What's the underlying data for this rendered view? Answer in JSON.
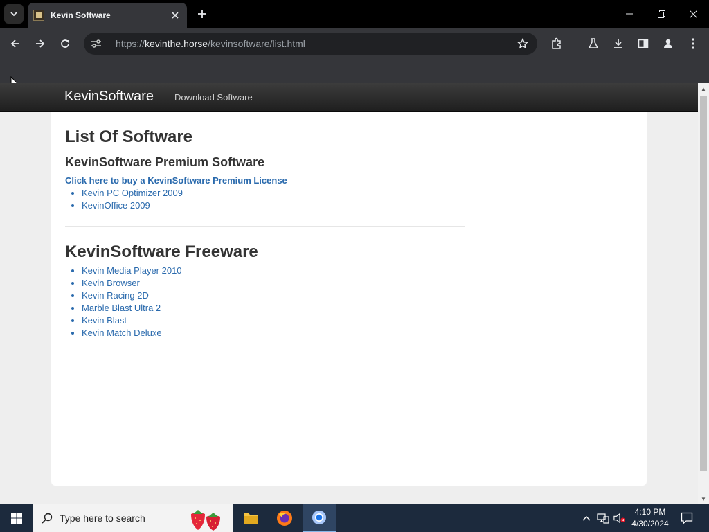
{
  "browser": {
    "tab_title": "Kevin Software",
    "url_scheme": "https://",
    "url_host": "kevinthe.horse",
    "url_path": "/kevinsoftware/list.html"
  },
  "site": {
    "brand": "KevinSoftware",
    "nav_link": "Download Software"
  },
  "page": {
    "title": "List Of Software",
    "premium_heading": "KevinSoftware Premium Software",
    "buy_link": "Click here to buy a KevinSoftware Premium License",
    "premium_items": [
      "Kevin PC Optimizer 2009",
      "KevinOffice 2009"
    ],
    "freeware_heading": "KevinSoftware Freeware",
    "freeware_items": [
      "Kevin Media Player 2010",
      "Kevin Browser",
      "Kevin Racing 2D",
      "Marble Blast Ultra 2",
      "Kevin Blast",
      "Kevin Match Deluxe"
    ]
  },
  "taskbar": {
    "search_placeholder": "Type here to search",
    "time": "4:10 PM",
    "date": "4/30/2024"
  },
  "colors": {
    "link": "#2a6aad",
    "heading": "#333333",
    "navbar": "#2b2b2b"
  }
}
